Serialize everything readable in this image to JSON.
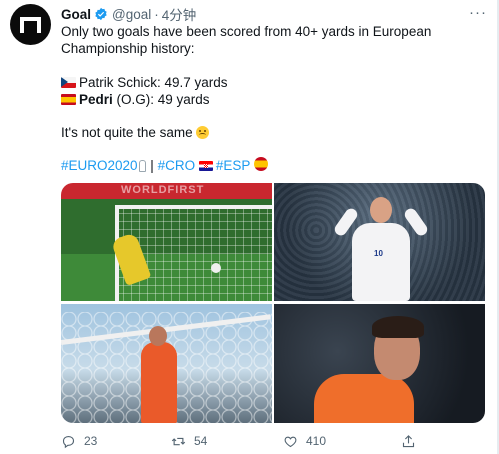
{
  "tweet": {
    "name": "Goal",
    "handle": "@goal",
    "separator": "·",
    "time": "4分钟",
    "more": "···",
    "line1": "Only two goals have been scored from 40+ yards in European",
    "line2": "Championship history:",
    "fact1": "Patrik Schick: 49.7 yards",
    "fact2_bold": "Pedri",
    "fact2_rest": " (O.G): 49 yards",
    "closing": "It's not quite the same",
    "hashtags": {
      "euro": "#EURO2020",
      "separator": " | ",
      "cro": "#CRO",
      "esp": "#ESP"
    },
    "icons": {
      "avatar": "goal-logo",
      "verified": "verified-badge-icon",
      "emoji": "upside-down-face-emoji",
      "trophy": "trophy-icon"
    }
  },
  "media": {
    "photo1": {
      "label": "goalkeeper-diving-photo",
      "banner": "WORLDFIRST"
    },
    "photo2": {
      "label": "schick-celebration-photo",
      "number": "10"
    },
    "photo3": {
      "label": "keeper-watching-ball-photo"
    },
    "photo4": {
      "label": "dejected-keeper-photo"
    }
  },
  "actions": {
    "reply_count": "23",
    "retweet_count": "54",
    "like_count": "410",
    "accent": "#536471",
    "link_color": "#1d9bf0"
  }
}
